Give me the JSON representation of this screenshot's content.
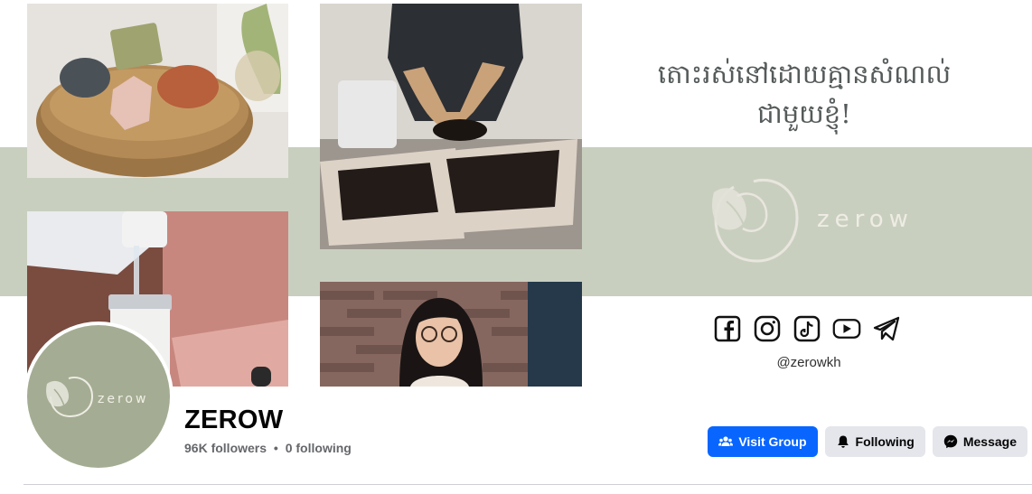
{
  "cover": {
    "heading_line1": "តោះរស់នៅដោយគ្មានសំណល់",
    "heading_line2": "ជាមួយខ្ញុំ!",
    "logo_text": "zerow",
    "handle": "@zerowkh",
    "social_icons": [
      "facebook-icon",
      "instagram-icon",
      "tiktok-icon",
      "youtube-icon",
      "telegram-icon"
    ],
    "band_color": "#c9cfbf"
  },
  "profile": {
    "name": "ZEROW",
    "followers": "96K followers",
    "separator": "•",
    "following": "0 following",
    "avatar_text": "zerow",
    "avatar_color": "#a4ad93"
  },
  "actions": {
    "visit_group": "Visit Group",
    "following": "Following",
    "message": "Message",
    "primary_color": "#0866ff"
  }
}
